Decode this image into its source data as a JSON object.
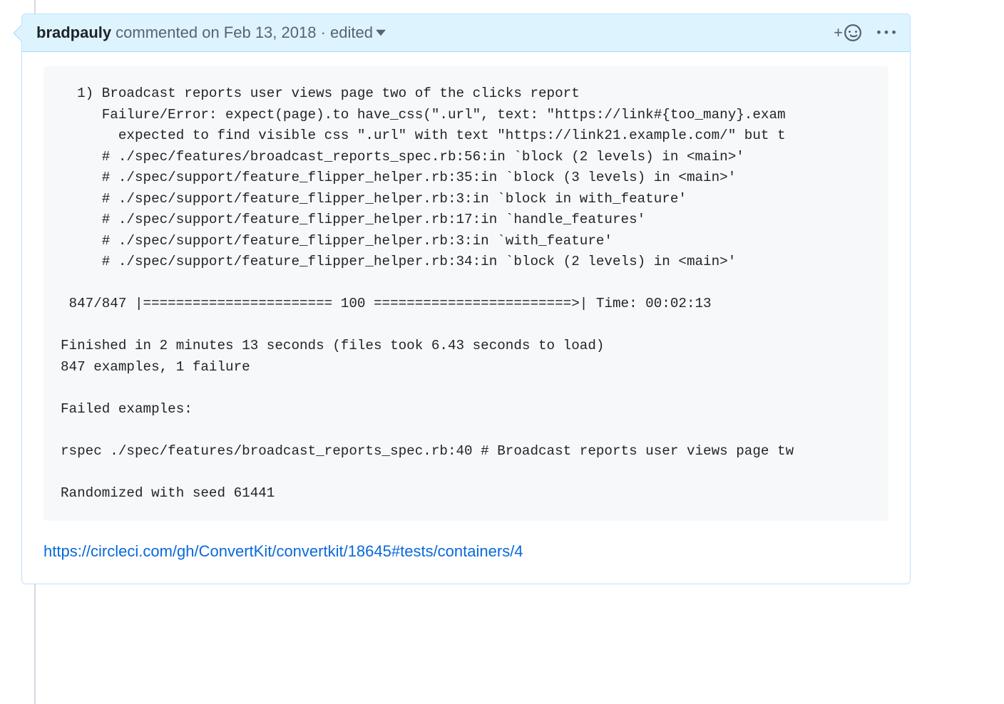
{
  "header": {
    "author": "bradpauly",
    "commented_label": "commented",
    "timestamp": "on Feb 13, 2018",
    "separator": "·",
    "edited_label": "edited",
    "reaction_plus": "+"
  },
  "body": {
    "code": "  1) Broadcast reports user views page two of the clicks report\n     Failure/Error: expect(page).to have_css(\".url\", text: \"https://link#{too_many}.exam\n       expected to find visible css \".url\" with text \"https://link21.example.com/\" but t\n     # ./spec/features/broadcast_reports_spec.rb:56:in `block (2 levels) in <main>'\n     # ./spec/support/feature_flipper_helper.rb:35:in `block (3 levels) in <main>'\n     # ./spec/support/feature_flipper_helper.rb:3:in `block in with_feature'\n     # ./spec/support/feature_flipper_helper.rb:17:in `handle_features'\n     # ./spec/support/feature_flipper_helper.rb:3:in `with_feature'\n     # ./spec/support/feature_flipper_helper.rb:34:in `block (2 levels) in <main>'\n\n 847/847 |======================= 100 ========================>| Time: 00:02:13\n\nFinished in 2 minutes 13 seconds (files took 6.43 seconds to load)\n847 examples, 1 failure\n\nFailed examples:\n\nrspec ./spec/features/broadcast_reports_spec.rb:40 # Broadcast reports user views page tw\n\nRandomized with seed 61441",
    "link_text": "https://circleci.com/gh/ConvertKit/convertkit/18645#tests/containers/4"
  }
}
